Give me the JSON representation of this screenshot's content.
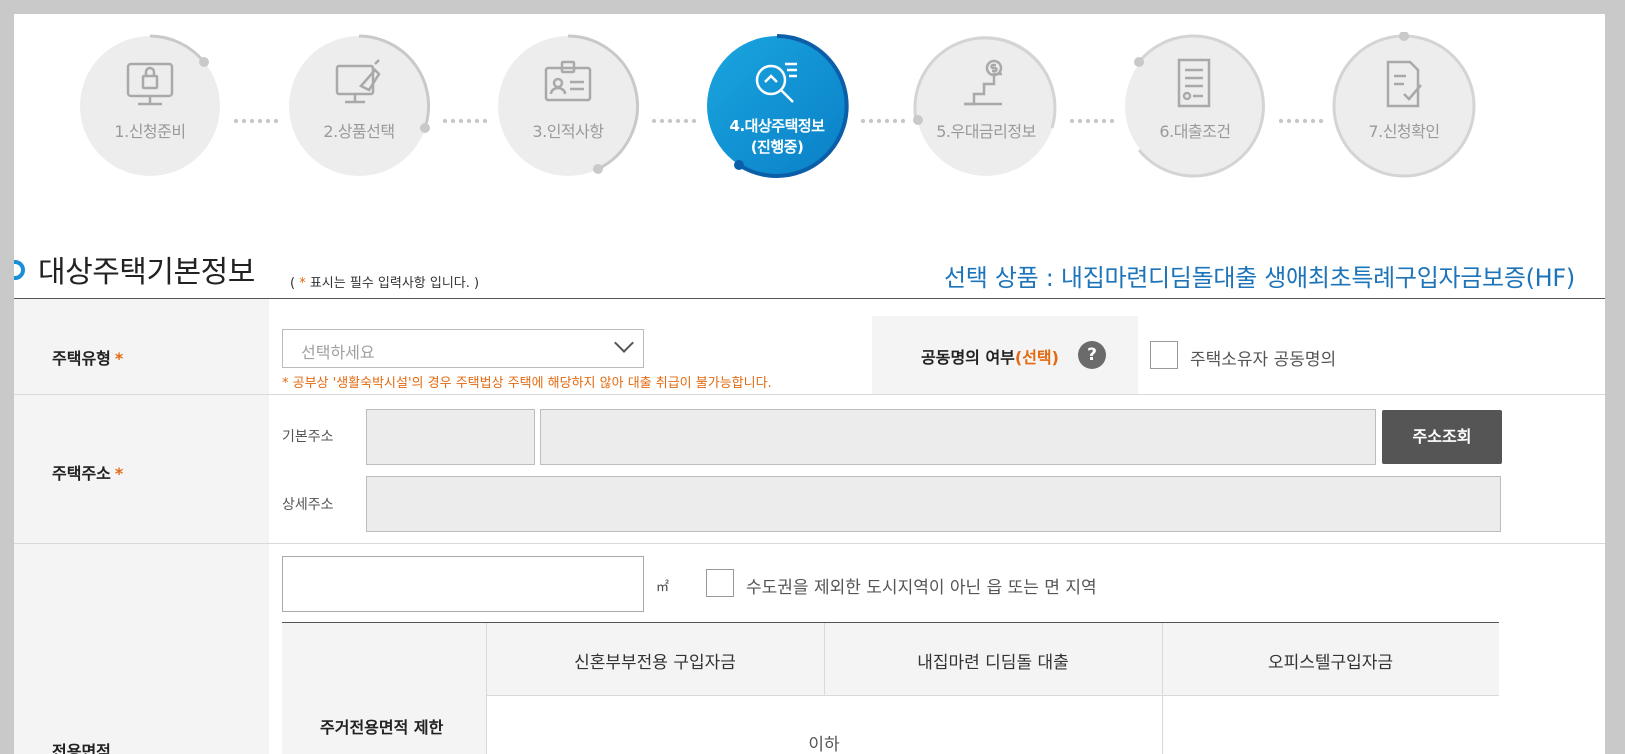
{
  "steps": [
    {
      "label": "1.신청준비",
      "icon": "computer-lock-icon"
    },
    {
      "label": "2.상품선택",
      "icon": "monitor-hand-icon"
    },
    {
      "label": "3.인적사항",
      "icon": "id-card-icon"
    },
    {
      "label_line1": "4.대상주택정보",
      "label_line2": "(진행중)",
      "icon": "house-search-icon"
    },
    {
      "label": "5.우대금리정보",
      "icon": "stairs-dollar-icon"
    },
    {
      "label": "6.대출조건",
      "icon": "document-list-icon"
    },
    {
      "label": "7.신청확인",
      "icon": "document-check-icon"
    }
  ],
  "section": {
    "title": "대상주택기본정보",
    "note_open": "( ",
    "note_star": "*",
    "note_text": " 표시는 필수 입력사항 입니다. )",
    "product": "선택 상품 : 내집마련디딤돌대출 생애최초특례구입자금보증(HF)"
  },
  "house_type": {
    "label": "주택유형",
    "required": "*",
    "placeholder": "선택하세요",
    "warning": "* 공부상 '생활숙박시설'의 경우 주택법상 주택에 해당하지 않아 대출 취급이 불가능합니다."
  },
  "co_owner": {
    "label": "공동명의 여부",
    "optional": "(선택)",
    "help": "?",
    "checkbox_label": "주택소유자 공동명의"
  },
  "address": {
    "label": "주택주소",
    "required": "*",
    "basic_label": "기본주소",
    "detail_label": "상세주소",
    "search_button": "주소조회"
  },
  "area": {
    "unit": "㎡",
    "checkbox_label": "수도권을 제외한 도시지역이 아닌 읍 또는 면 지역",
    "row_label": "전용면적",
    "limit_label": "주거전용면적 제한",
    "columns": [
      "신혼부부전용 구입자금",
      "내집마련 디딤돌 대출",
      "오피스텔구입자금"
    ],
    "cell_partial": "이하"
  },
  "colors": {
    "accent": "#1a8fd6",
    "required": "#e36a12",
    "product": "#1e74b8"
  }
}
